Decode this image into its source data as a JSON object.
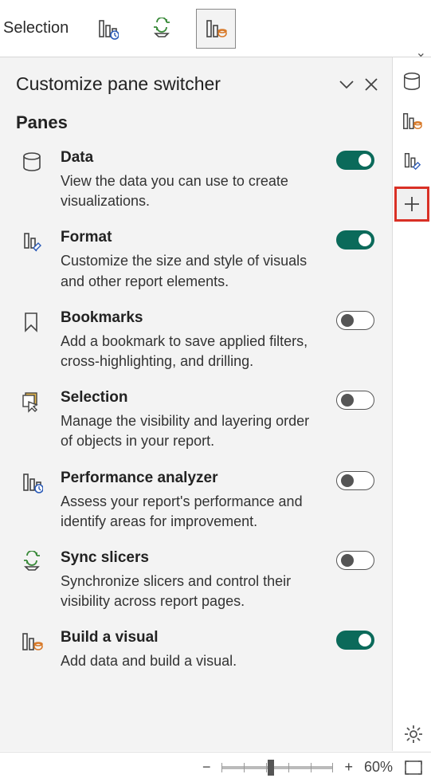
{
  "toolbar": {
    "selection_label": "Selection"
  },
  "panel": {
    "title": "Customize pane switcher",
    "subtitle": "Panes",
    "items": [
      {
        "title": "Data",
        "desc": "View the data you can use to create visualizations.",
        "on": true
      },
      {
        "title": "Format",
        "desc": "Customize the size and style of visuals and other report elements.",
        "on": true
      },
      {
        "title": "Bookmarks",
        "desc": "Add a bookmark to save applied filters, cross-highlighting, and drilling.",
        "on": false
      },
      {
        "title": "Selection",
        "desc": "Manage the visibility and layering order of objects in your report.",
        "on": false
      },
      {
        "title": "Performance analyzer",
        "desc": "Assess your report's performance and identify areas for improvement.",
        "on": false
      },
      {
        "title": "Sync slicers",
        "desc": "Synchronize slicers and control their visibility across report pages.",
        "on": false
      },
      {
        "title": "Build a visual",
        "desc": "Add data and build a visual.",
        "on": true
      }
    ]
  },
  "statusbar": {
    "zoom_minus": "−",
    "zoom_plus": "+",
    "zoom_value": "60%"
  },
  "colors": {
    "accent_green": "#0b6a5a",
    "highlight_red": "#d93025"
  }
}
